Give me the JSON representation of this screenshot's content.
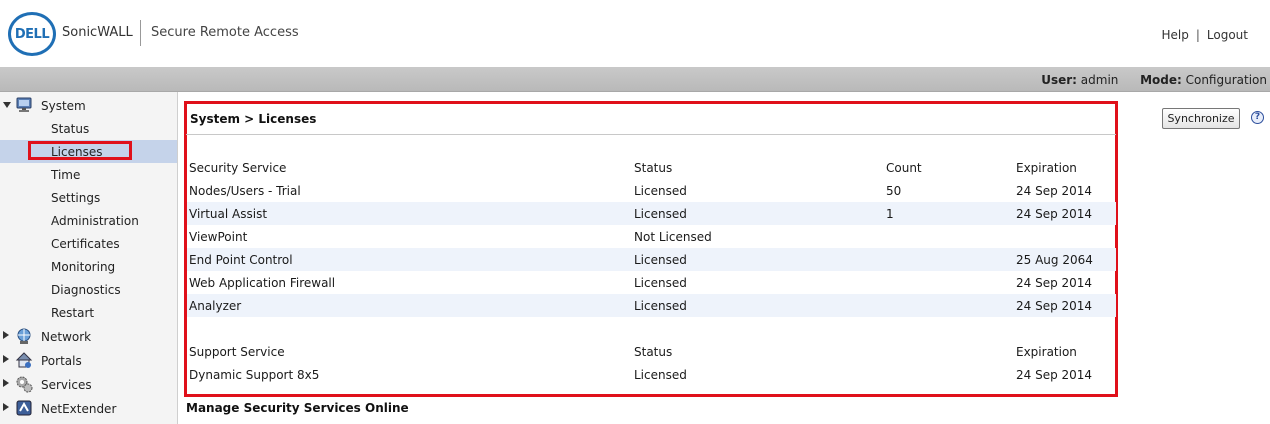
{
  "header": {
    "logo_text": "DELL",
    "brand": "SonicWALL",
    "product": "Secure Remote Access",
    "links": {
      "help": "Help",
      "separator": "|",
      "logout": "Logout"
    }
  },
  "statusbar": {
    "user_label": "User:",
    "user_value": "admin",
    "mode_label": "Mode:",
    "mode_value": "Configuration"
  },
  "sidebar": {
    "system": {
      "label": "System",
      "icon": "monitor-icon",
      "expanded": true,
      "items": [
        "Status",
        "Licenses",
        "Time",
        "Settings",
        "Administration",
        "Certificates",
        "Monitoring",
        "Diagnostics",
        "Restart"
      ],
      "active": "Licenses"
    },
    "groups": [
      {
        "label": "Network",
        "icon": "globe-icon"
      },
      {
        "label": "Portals",
        "icon": "house-icon"
      },
      {
        "label": "Services",
        "icon": "gears-icon"
      },
      {
        "label": "NetExtender",
        "icon": "netextender-icon"
      }
    ]
  },
  "main": {
    "breadcrumb": "System > Licenses",
    "sync_button": "Synchronize",
    "help_icon": "?",
    "security": {
      "headers": [
        "Security Service",
        "Status",
        "Count",
        "Expiration"
      ],
      "rows": [
        [
          "Nodes/Users - Trial",
          "Licensed",
          "50",
          "24 Sep 2014"
        ],
        [
          "Virtual Assist",
          "Licensed",
          "1",
          "24 Sep 2014"
        ],
        [
          "ViewPoint",
          "Not Licensed",
          "",
          ""
        ],
        [
          "End Point Control",
          "Licensed",
          "",
          "25 Aug 2064"
        ],
        [
          "Web Application Firewall",
          "Licensed",
          "",
          "24 Sep 2014"
        ],
        [
          "Analyzer",
          "Licensed",
          "",
          "24 Sep 2014"
        ]
      ]
    },
    "support": {
      "headers": [
        "Support Service",
        "Status",
        "Expiration"
      ],
      "rows": [
        [
          "Dynamic Support 8x5",
          "Licensed",
          "24 Sep 2014"
        ]
      ]
    },
    "manage_heading": "Manage Security Services Online"
  },
  "colors": {
    "highlight_border": "#e0101a",
    "accent_blue": "#1f6fb5",
    "active_bg": "#c5d3ea",
    "alt_row_bg": "#eef3fb"
  }
}
